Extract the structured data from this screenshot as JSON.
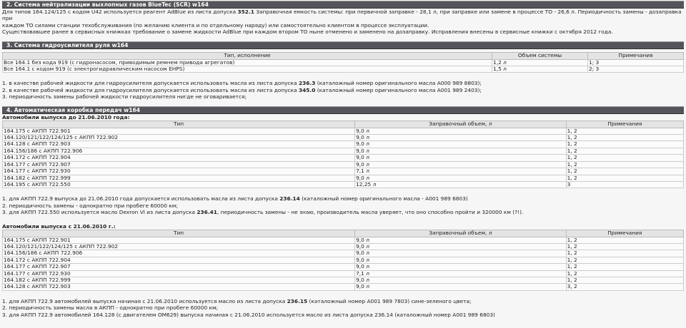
{
  "sec2": {
    "title": "2. Система нейтрализации выхлопных газов BlueTec (SCR) w164",
    "p1a": "Для типов 164.124/125 с кодом U42 используется реагент AdBlue из листа допуска ",
    "p1b": "352.1",
    "p1c": " Заправочная емкость системы: при первичной заправке - 28,1 л, при заправке или замене в процессе ТО - 26,6 л. Периодичность замены - дозаправка при",
    "p2": "каждом ТО силами станции техобслуживания (по желанию клиента и по отдельному наряду) или самостоятельно клиентом в процессе эксплуатации.",
    "p3": "Существовавшее ранее в сервисных книжках требование о замене жидкости AdBlue при каждом втором ТО ныне отменено и заменено на дозаправку. Исправления внесены в сервисные книжки с октября 2012 года."
  },
  "sec3": {
    "title": "3. Система гидроусилителя руля w164",
    "headers": [
      "Тип, исполнение",
      "Объем системы",
      "Примечания"
    ],
    "rows": [
      [
        "Все 164.1 без кода 919 (с гидронасосом, приводимым ремнем привода агрегатов)",
        "1,2 л",
        "1; 3"
      ],
      [
        "Все 164.1 с кодом 919 (с электрогидравлическим насосом EHPS)",
        "1,5 л",
        "2; 3"
      ]
    ],
    "n1a": "1. в качестве рабочей жидкости для гидроусилителя допускается использовать масла из листа допуска ",
    "n1b": "236.3",
    "n1c": " (каталожный номер оригинального масла A000 989 8803);",
    "n2a": "2. в качестве рабочей жидкости для гидроусилителя допускается использовать масла из листа допуска ",
    "n2b": "345.0",
    "n2c": " (каталожный номер оригинального масла A001 989 2403);",
    "n3": "3. периодичность замены рабочей жидкости гидроусилителя нигде не оговаривается;"
  },
  "sec4": {
    "title": "4. Автоматическая коробка передач w164",
    "sub1": "Автомобили выпуска до 21.06.2010 года:",
    "headers": [
      "Тип",
      "Заправочный объем, л",
      "Примечания"
    ],
    "rows1": [
      [
        "164.175 с АКПП 722.901",
        "9,0 л",
        "1, 2"
      ],
      [
        "164.120/121/122/124/125 с АКПП 722.902",
        "9,0 л",
        "1, 2"
      ],
      [
        "164.128 с АКПП 722.903",
        "9,0 л",
        "1, 2"
      ],
      [
        "164.156/186 с АКПП 722.906",
        "9,0 л",
        "1, 2"
      ],
      [
        "164.172 с АКПП 722.904",
        "9,0 л",
        "1, 2"
      ],
      [
        "164.177 с АКПП 722.907",
        "9,0 л",
        "1, 2"
      ],
      [
        "164.177 с АКПП 722.930",
        "7,1 л",
        "1, 2"
      ],
      [
        "164.182 с АКПП 722.999",
        "9,0 л",
        "1, 2"
      ],
      [
        "164.195 с АКПП 722.550",
        "12,25 л",
        "3"
      ]
    ],
    "n1a": "1. для АКПП 722.9 выпуска до 21.06.2010 года допускается использовать масла из листа допуска ",
    "n1b": "236.14",
    "n1c": " (каталожный номер оригинального масла - A001 989 6803)",
    "n2": "2. периодичность замены - однократно при пробеге 60000 км;",
    "n3a": "3. для АКПП 722.550 используется масло Dexron VI из листа допуска ",
    "n3b": "236.41",
    "n3c": ", периодичность замены - не знаю, производитель масла уверяет, что оно способно пройти и 320000 км (?!).",
    "sub2": "Автомобили выпуска с 21.06.2010 г.:",
    "rows2": [
      [
        "164.175 с АКПП 722.901",
        "9,0 л",
        "1, 2"
      ],
      [
        "164.120/121/122/124/125 с АКПП 722.902",
        "9,0 л",
        "1, 2"
      ],
      [
        "164.156/186 с АКПП 722.906",
        "9,0 л",
        "1, 2"
      ],
      [
        "164.172 с АКПП 722.904",
        "9,0 л",
        "1, 2"
      ],
      [
        "164.177 с АКПП 722.907",
        "9,0 л",
        "1, 2"
      ],
      [
        "164.177 с АКПП 722.930",
        "7,1 л",
        "1, 2"
      ],
      [
        "164.182 с АКПП 722.999",
        "9,0 л",
        "1, 2"
      ],
      [
        "164.128 с АКПП 722.903",
        "9,0 л",
        "3, 2"
      ]
    ],
    "m1a": "1. для АКПП 722.9 автомобилей выпуска начиная с 21.06.2010 используется масло из листа допуска ",
    "m1b": "236.15",
    "m1c": " (каталожный номер A001 989 7803) сине-зеленого цвета;",
    "m2": "2. периодичность замены масла в АКПП - однократно при пробеге 60000 км;",
    "m3": "3. для АКПП 722.9 автомобилей 164.128 (с двигателем OM629) выпуска начиная с 21.06.2010 используется масло из листа допуска 236.14 (каталожный номер A001 989 6803)"
  }
}
